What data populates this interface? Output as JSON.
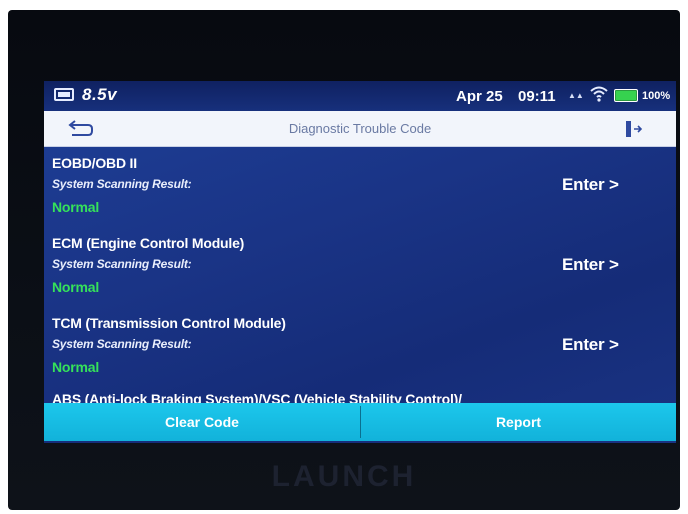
{
  "status_bar": {
    "voltage": "8.5v",
    "date": "Apr 25",
    "time": "09:11",
    "battery_percent": "100%",
    "battery_level": 1.0,
    "icons": [
      "battery-icon",
      "signal-icon",
      "wifi-icon",
      "battery-level-icon"
    ]
  },
  "header": {
    "title": "Diagnostic Trouble Code",
    "back_icon": "back-arrow-icon",
    "exit_icon": "exit-icon"
  },
  "systems": [
    {
      "name": "EOBD/OBD II",
      "result_label": "System Scanning Result:",
      "status": "Normal",
      "action_label": "Enter >"
    },
    {
      "name": "ECM (Engine Control Module)",
      "result_label": "System Scanning Result:",
      "status": "Normal",
      "action_label": "Enter >"
    },
    {
      "name": "TCM (Transmission Control Module)",
      "result_label": "System Scanning Result:",
      "status": "Normal",
      "action_label": "Enter >"
    }
  ],
  "partial_item": {
    "name": "ABS (Anti-lock Braking System)/VSC (Vehicle Stability Control)/"
  },
  "actions": {
    "clear_code": "Clear Code",
    "report": "Report"
  },
  "device": {
    "brand": "LAUNCH"
  },
  "colors": {
    "screen_bg": "#1a3486",
    "status_normal": "#35e25a",
    "action_bar": "#16bde4",
    "title_bar": "#f2f5fb"
  }
}
